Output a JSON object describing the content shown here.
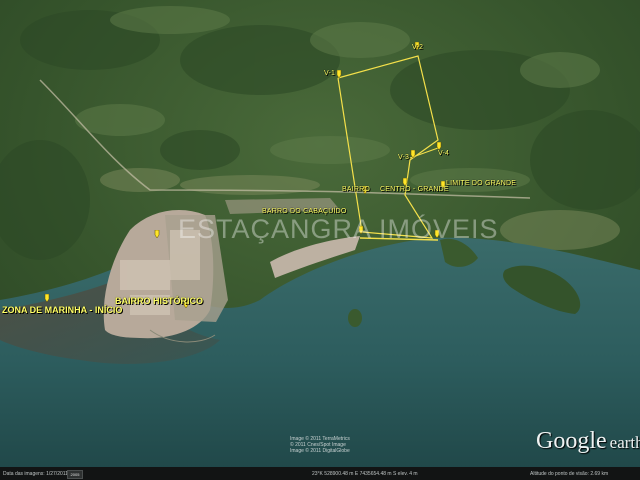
{
  "map": {
    "kind": "satellite-imagery",
    "colors": {
      "sea": "#2c5a5b",
      "bay": "#3f4a44",
      "forest": "#3b5a2e",
      "urban": "#b7a99a",
      "route": "#f4e04a",
      "label": "#ffff66"
    }
  },
  "place_labels": {
    "zona_inicio": "ZONA DE MARINHA - INÍCIO",
    "bairro_historico": "BAIRRO HISTÓRICO",
    "barra_grande": "BARRO DO CABAÇUÍDO",
    "bairro_label": "BAIRRO",
    "vertice_norte": "V-2",
    "vertice_oeste": "V-1",
    "vertice_leste": "V-3",
    "vertice_sul": "V-4",
    "centro_label": "CENTRO - GRANDE",
    "rio_label": "LIMITE DO GRANDE"
  },
  "pin_icon": "placemark-pushpin-icon",
  "watermark": "ESTAÇANGRA IMÓVEIS",
  "attribution": {
    "line1": "Image © 2011 TerraMetrics",
    "line2": "© 2011 Cnes/Spot Image",
    "line3": "Image © 2011 DigitalGlobe"
  },
  "logo": {
    "google": "Google",
    "earth": "earth"
  },
  "status_bar": {
    "imagery_date": "Data das imagens: 1/27/2011",
    "badge": "2005",
    "coordinates": "23°K 528900.48 m E 7435654.48 m S elev. 4 m",
    "eye_altitude": "Altitude do ponto de visão: 2.69 km"
  }
}
